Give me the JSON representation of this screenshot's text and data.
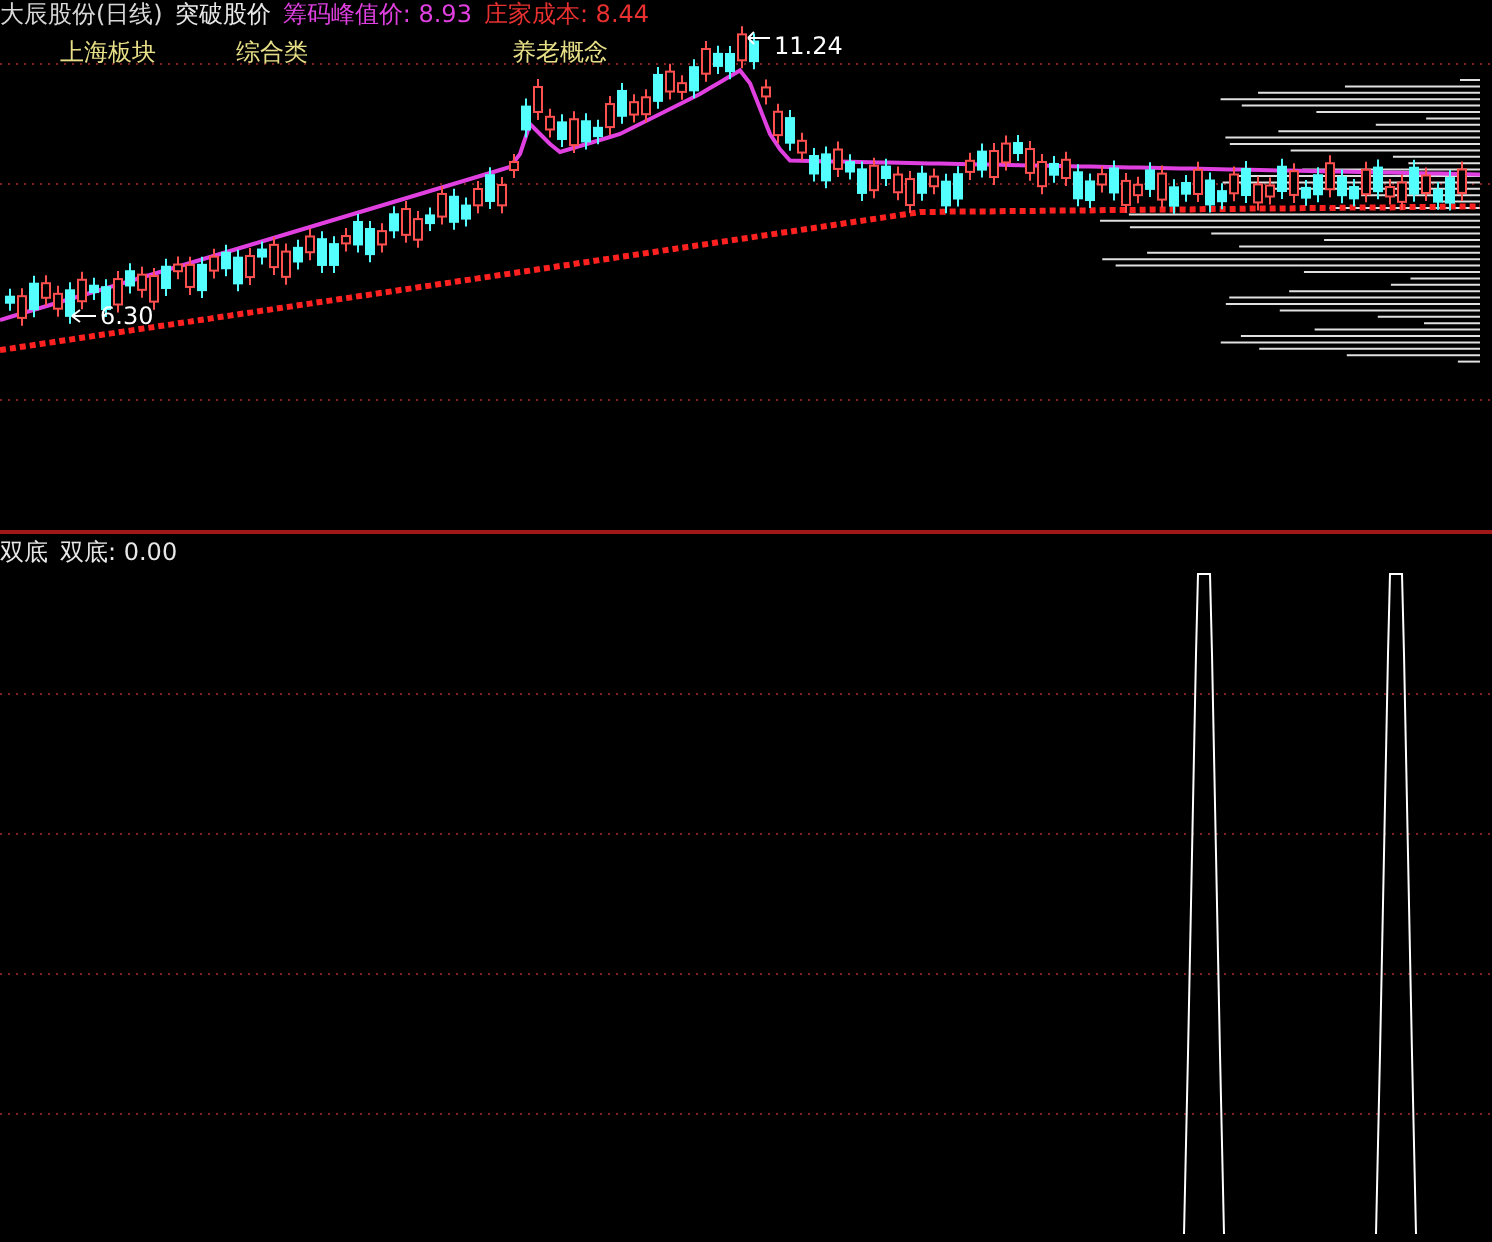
{
  "header": {
    "title": "大辰股份(日线)",
    "indicator": "突破股价",
    "chip_peak": "筹码峰值价: 8.93",
    "dealer_cost": "庄家成本: 8.44"
  },
  "sector_tags": [
    "上海板块",
    "综合类",
    "养老概念"
  ],
  "price_labels": {
    "high": "11.24",
    "low": "6.30"
  },
  "lower_panel": {
    "name": "双底",
    "reading": "双底: 0.00"
  }
}
